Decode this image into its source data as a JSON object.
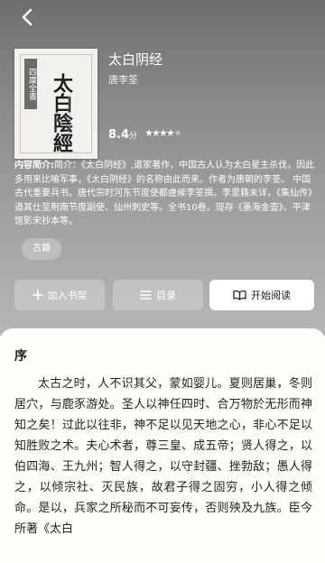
{
  "nav": {
    "back_icon": "chevron-left-icon"
  },
  "book": {
    "cover": {
      "series_label": "四庫全書",
      "title_art": "太白陰經"
    },
    "title": "太白阴经",
    "author": "唐李筌",
    "rating_score": "8.4",
    "rating_unit": "分",
    "rating_stars": 4,
    "intro_label": "内容简介:",
    "intro_text": "简介：《太白阴经》,道家著作，中国古人认为太白星主杀伐，因此多用来比喻军事，《太白阴经》的名称由此而来。作者为唐朝的李筌。 中国古代重要兵书。唐代宗时河东节度使都虞候李筌撰。李里籍未详，《集仙传》道其仕至荆南节度副使、仙州刺史等。全书10卷。现存《墨海金壶》、平津馆影宋抄本等。",
    "tag": "古籍"
  },
  "actions": {
    "add_shelf": "加入书架",
    "toc": "目录",
    "start_reading": "开始阅读"
  },
  "excerpt": {
    "section_title": "序",
    "text": "太古之时，人不识其父，蒙如婴儿。夏则居巢，冬则居穴，与鹿豕游处。圣人以神任四时、合万物於无形而神知之矣！过此以往非，神不足以见天地之心，非心不足以知胜败之术。夫心术者，尊三皇、成五帝；贤人得之，以伯四海、王九州；智人得之，以守封疆、挫勃敌；愚人得之，以倾宗社、灭民族，故君子得之固穷，小人得之倾命。是以，兵家之所秘而不可妄传，否则殃及九族。臣今所著《太白"
  }
}
